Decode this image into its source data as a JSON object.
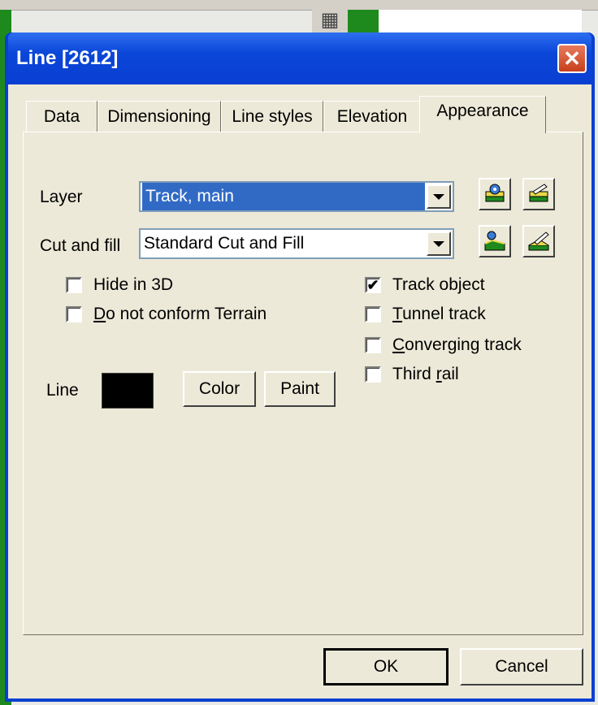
{
  "dialog": {
    "title": "Line [2612]",
    "close_glyph": "✕"
  },
  "background": {
    "icon": "grid-icon",
    "icon_glyph": "▦"
  },
  "tabs": [
    {
      "label": "Data",
      "active": false
    },
    {
      "label": "Dimensioning",
      "active": false
    },
    {
      "label": "Line styles",
      "active": false
    },
    {
      "label": "Elevation",
      "active": false
    },
    {
      "label": "Appearance",
      "active": true
    }
  ],
  "layer": {
    "label": "Layer",
    "value": "Track, main"
  },
  "cut_fill": {
    "label": "Cut and fill",
    "value": "Standard Cut and Fill"
  },
  "checkboxes": {
    "hide3d": {
      "label": "Hide in 3D",
      "checked": false
    },
    "no_conform_pre": "",
    "no_conform_u": "D",
    "no_conform_rest": "o not conform Terrain",
    "track_object": {
      "label": "Track object",
      "checked": true
    },
    "tunnel_u": "T",
    "tunnel_rest": "unnel track",
    "converging_u": "C",
    "converging_rest": "onverging track",
    "third_pre": "Third ",
    "third_u": "r",
    "third_rest": "ail"
  },
  "line": {
    "label": "Line",
    "color": "#000000",
    "color_button": "Color",
    "paint_button": "Paint"
  },
  "buttons": {
    "ok": "OK",
    "cancel": "Cancel"
  },
  "colors": {
    "titlebar": "#0a3fd2",
    "selection": "#316ac5",
    "accent_green": "#1e8a1e"
  }
}
